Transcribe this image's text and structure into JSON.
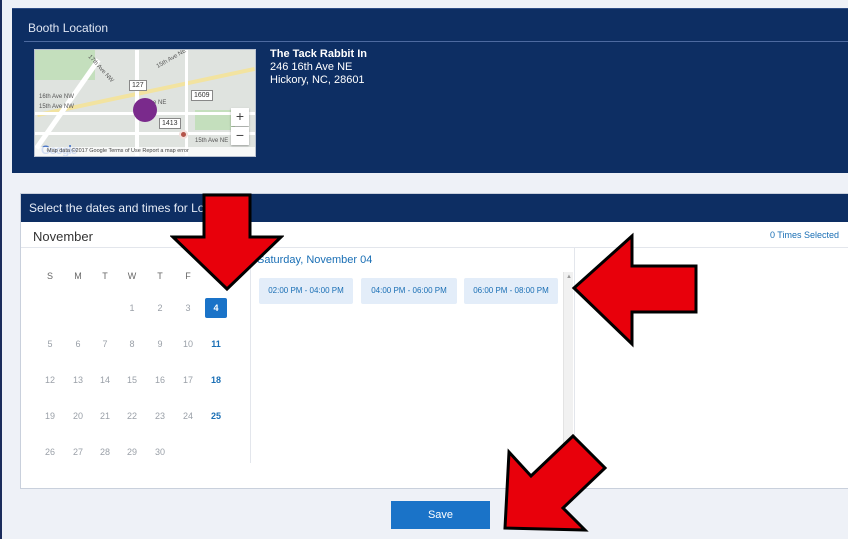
{
  "booth": {
    "title": "Booth Location",
    "name": "The Tack Rabbit In",
    "street": "246 16th Ave NE",
    "city": "Hickory, NC, 28601",
    "map": {
      "labels": [
        "15th Ave NE",
        "17th Ave NW",
        "16th Ave NW",
        "15th Ave NW",
        "e NE",
        "15th Ave NE"
      ],
      "shields": [
        "127",
        "1609",
        "1413"
      ],
      "zoom_in": "+",
      "zoom_out": "−",
      "google": "Google",
      "attribution": "Map data ©2017 Google   Terms of Use   Report a map error"
    }
  },
  "selection": {
    "header": "Select the dates and times for Lot",
    "month": "November",
    "times_selected": "0 Times Selected",
    "day_title": "Saturday, November 04",
    "weekdays": [
      "S",
      "M",
      "T",
      "W",
      "T",
      "F",
      "S"
    ],
    "weeks": [
      [
        "",
        "",
        "",
        "1",
        "2",
        "3",
        "4"
      ],
      [
        "5",
        "6",
        "7",
        "8",
        "9",
        "10",
        "11"
      ],
      [
        "12",
        "13",
        "14",
        "15",
        "16",
        "17",
        "18"
      ],
      [
        "19",
        "20",
        "21",
        "22",
        "23",
        "24",
        "25"
      ],
      [
        "26",
        "27",
        "28",
        "29",
        "30",
        "",
        ""
      ]
    ],
    "available_days": [
      "4",
      "11",
      "18",
      "25"
    ],
    "selected_day": "4",
    "time_slots": [
      "02:00 PM - 04:00 PM",
      "04:00 PM - 06:00 PM",
      "06:00 PM - 08:00 PM"
    ]
  },
  "save_label": "Save",
  "colors": {
    "navy": "#0d2e63",
    "accent": "#1a73c8",
    "annotation_arrow": "#e8000b"
  }
}
